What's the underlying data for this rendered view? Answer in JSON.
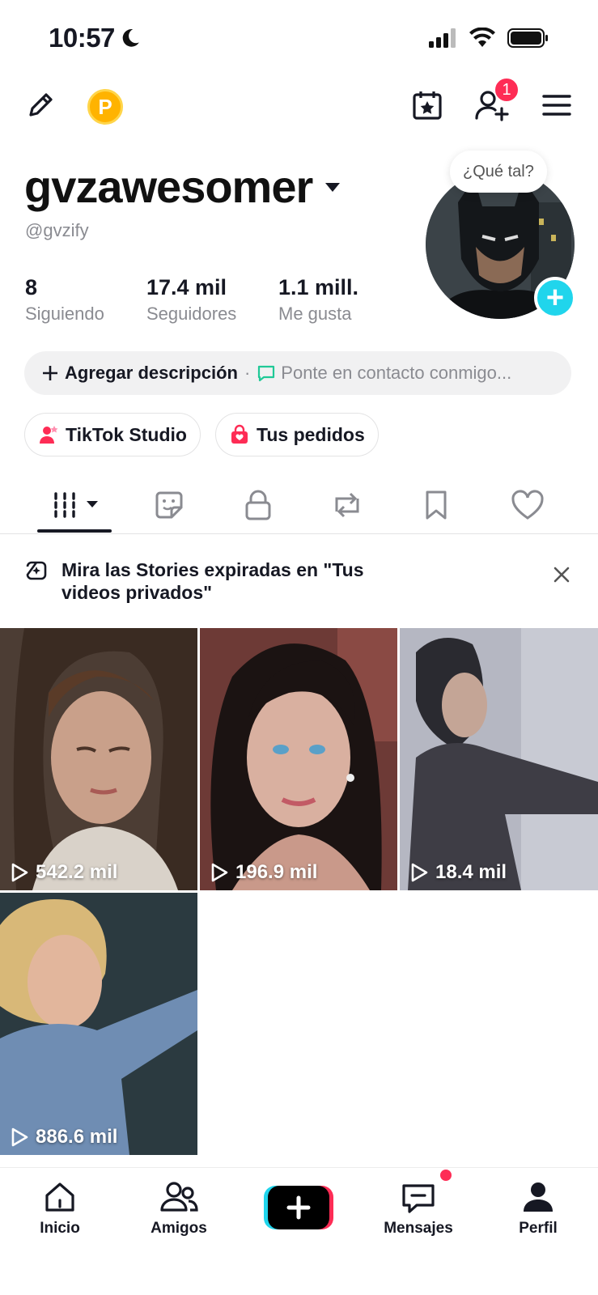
{
  "status_bar": {
    "time": "10:57"
  },
  "header": {
    "coin_letter": "P",
    "friend_badge": "1"
  },
  "profile": {
    "username": "gvzawesomer",
    "handle": "@gvzify",
    "avatar_bubble": "¿Qué tal?",
    "stats": [
      {
        "value": "8",
        "label": "Siguiendo"
      },
      {
        "value": "17.4 mil",
        "label": "Seguidores"
      },
      {
        "value": "1.1 mill.",
        "label": "Me gusta"
      }
    ],
    "add_description": "Agregar descripción",
    "separator": "·",
    "contact_placeholder": "Ponte en contacto conmigo..."
  },
  "pills": [
    {
      "label": "TikTok Studio",
      "icon": "tiktok-studio-icon"
    },
    {
      "label": "Tus pedidos",
      "icon": "shopping-bag-icon"
    }
  ],
  "tabs": [
    "videos-grid-icon",
    "stickers-icon",
    "lock-icon",
    "repost-icon",
    "bookmark-icon",
    "heart-icon"
  ],
  "notice": {
    "text": "Mira las Stories expiradas en \"Tus videos privados\""
  },
  "videos": [
    {
      "views": "542.2 mil"
    },
    {
      "views": "196.9 mil"
    },
    {
      "views": "18.4 mil"
    },
    {
      "views": "886.6 mil"
    }
  ],
  "bottom_nav": [
    {
      "label": "Inicio",
      "icon": "home-icon"
    },
    {
      "label": "Amigos",
      "icon": "friends-icon"
    },
    {
      "label": "",
      "icon": "create-plus-icon"
    },
    {
      "label": "Mensajes",
      "icon": "messages-icon"
    },
    {
      "label": "Perfil",
      "icon": "profile-icon"
    }
  ],
  "colors": {
    "accent": "#fe2c55",
    "cyan": "#20d5ec",
    "text": "#161823",
    "muted": "#8a8b91"
  }
}
